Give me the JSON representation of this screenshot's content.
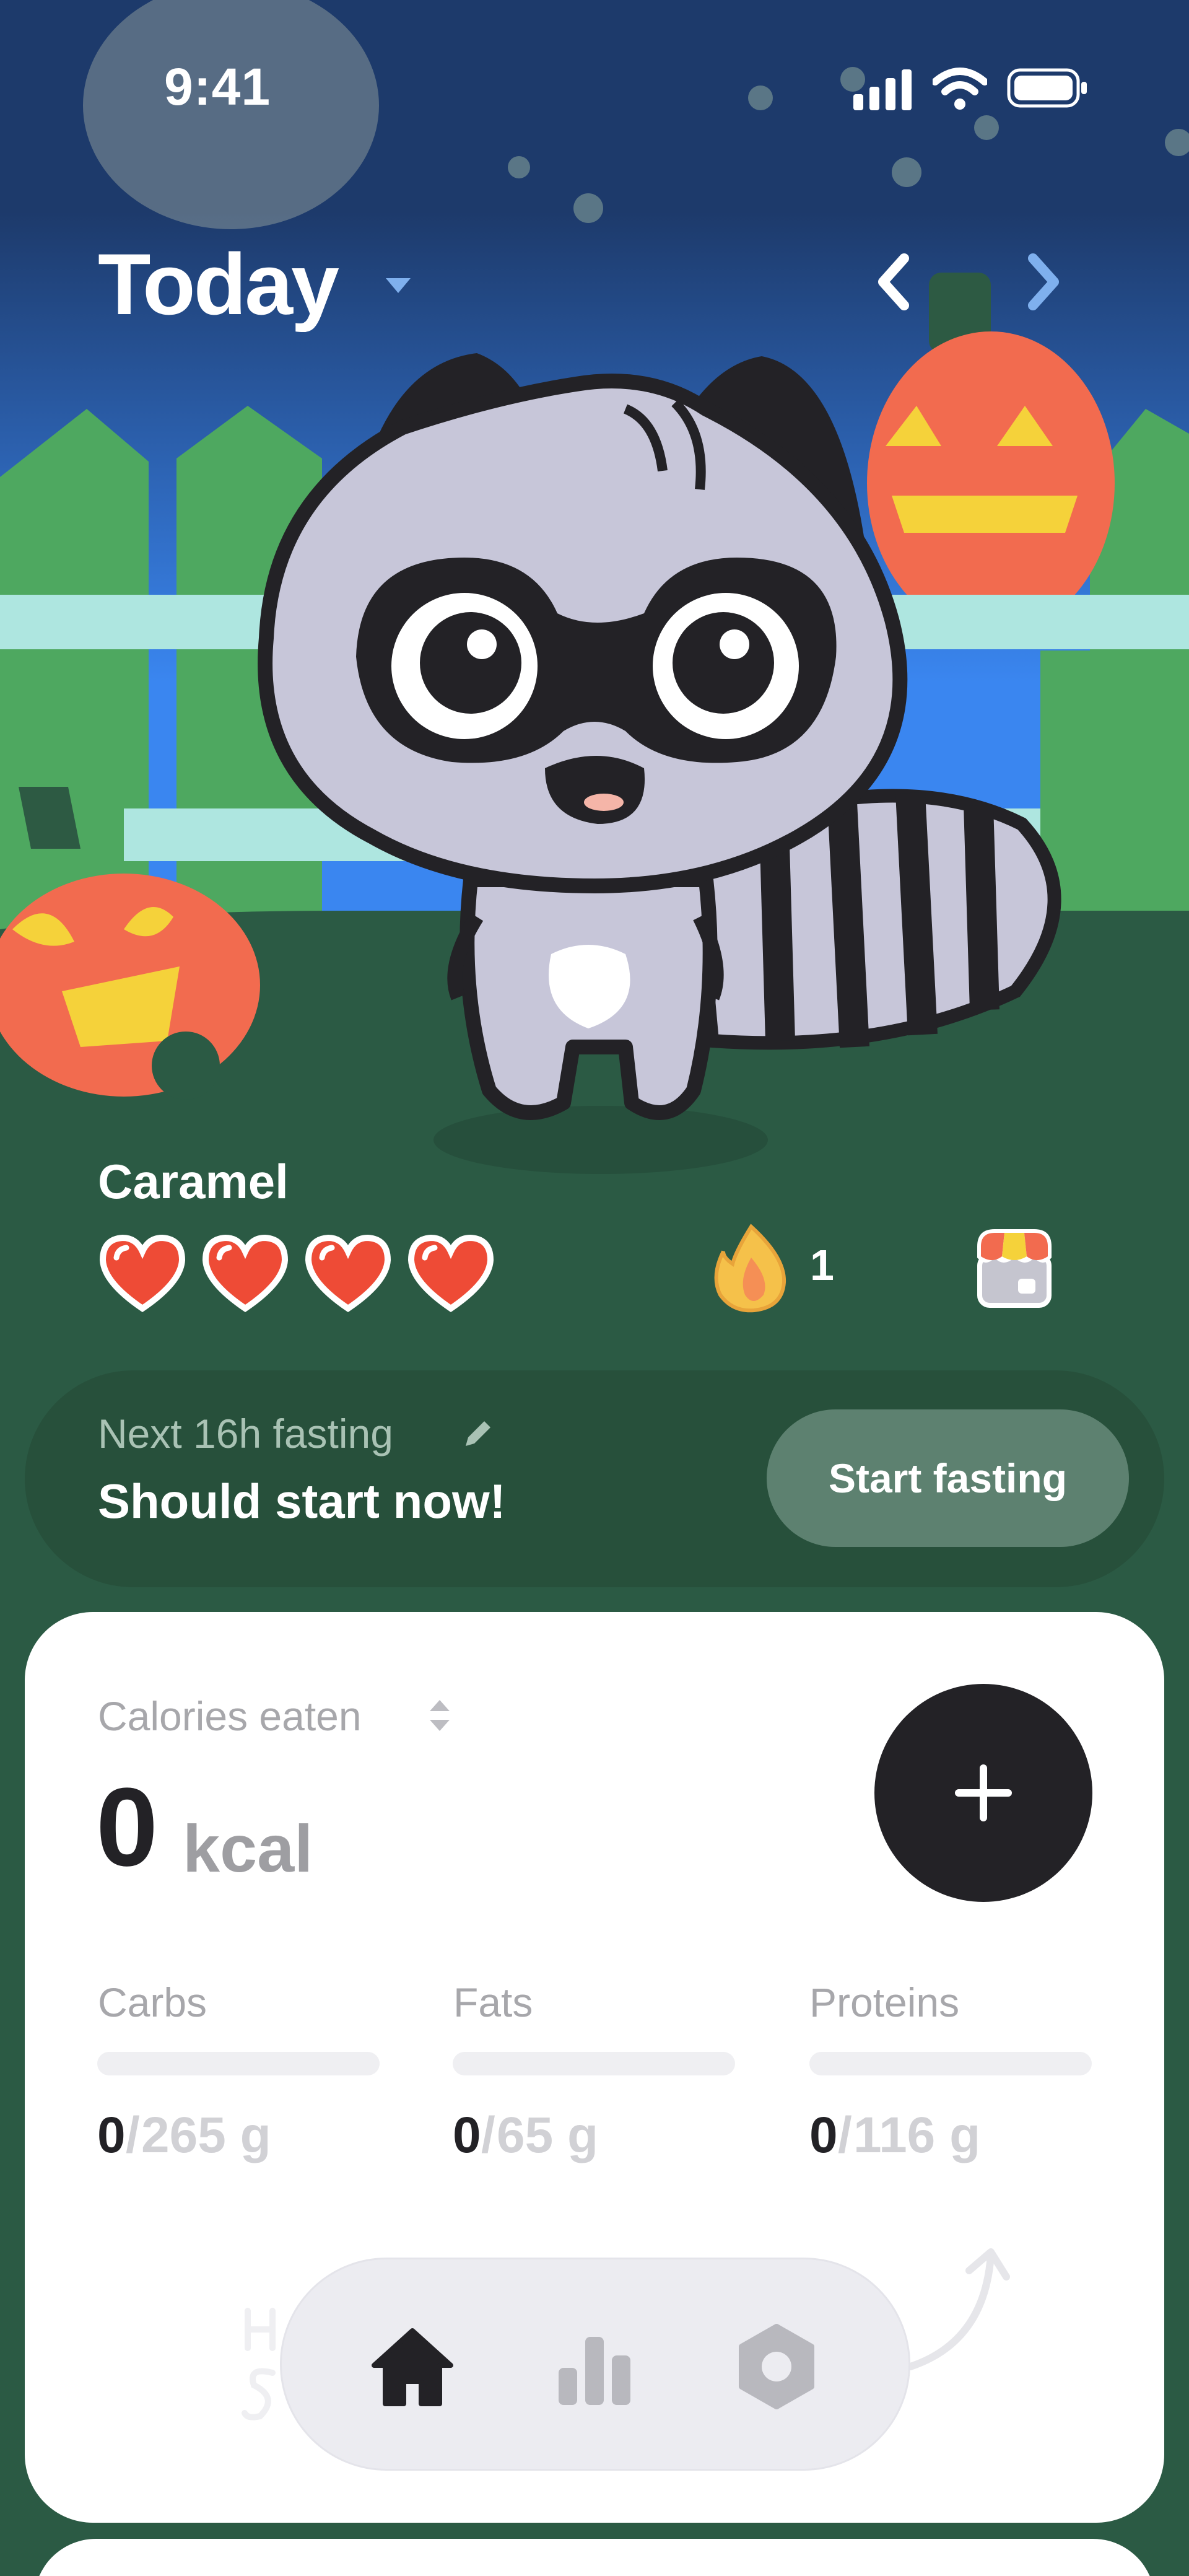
{
  "status_bar": {
    "time": "9:41"
  },
  "header": {
    "title": "Today"
  },
  "pet": {
    "name": "Caramel",
    "hearts": 4,
    "streak_count": "1"
  },
  "fasting": {
    "label": "Next 16h fasting",
    "status": "Should start now!",
    "button_label": "Start fasting"
  },
  "calories": {
    "label": "Calories eaten",
    "value": "0",
    "unit": "kcal"
  },
  "macros": [
    {
      "name": "Carbs",
      "eaten": "0",
      "goal": "265 g",
      "progress": 0
    },
    {
      "name": "Fats",
      "eaten": "0",
      "goal": "65 g",
      "progress": 0
    },
    {
      "name": "Proteins",
      "eaten": "0",
      "goal": "116 g",
      "progress": 0
    }
  ],
  "tabs": [
    {
      "name": "home",
      "icon": "home-icon",
      "active": true
    },
    {
      "name": "stats",
      "icon": "bar-chart-icon",
      "active": false
    },
    {
      "name": "settings",
      "icon": "hexagon-settings-icon",
      "active": false
    }
  ],
  "colors": {
    "background": "#2b5a44",
    "sky_top": "#1d3a6b",
    "sky_bottom": "#3a86f0",
    "accent_dark": "#232226",
    "pumpkin": "#f26b4f"
  },
  "macro_separator": "/"
}
